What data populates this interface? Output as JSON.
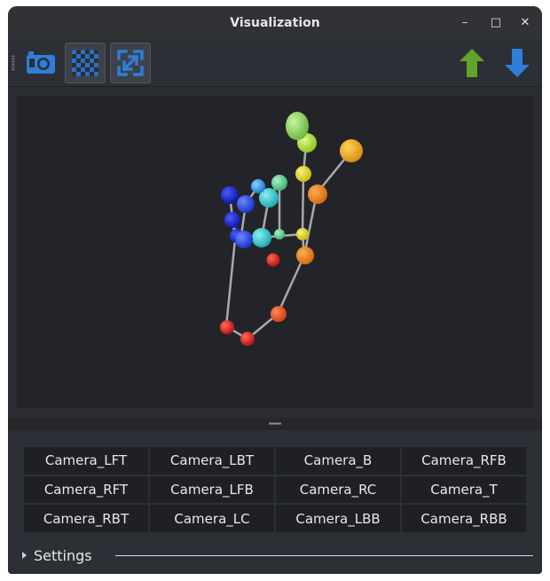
{
  "window": {
    "title": "Visualization",
    "minimize_glyph": "–",
    "maximize_glyph": "□",
    "close_glyph": "✕"
  },
  "toolbar": {
    "buttons": [
      {
        "icon": "camera-icon",
        "checked": false
      },
      {
        "icon": "checkerboard-icon",
        "checked": true
      },
      {
        "icon": "fit-view-icon",
        "checked": true
      }
    ],
    "right_buttons": [
      {
        "icon": "arrow-up-icon",
        "color": "#5fa52b"
      },
      {
        "icon": "arrow-down-icon",
        "color": "#2f7ed8"
      }
    ]
  },
  "cameras": {
    "labels": [
      "Camera_LFT",
      "Camera_LBT",
      "Camera_B",
      "Camera_RFB",
      "Camera_RFT",
      "Camera_LFB",
      "Camera_RC",
      "Camera_T",
      "Camera_RBT",
      "Camera_LC",
      "Camera_LBB",
      "Camera_RBB"
    ]
  },
  "settings": {
    "label": "Settings",
    "expanded": false
  },
  "colors": {
    "accent_blue": "#2f7ed8",
    "accent_green": "#5fa52b",
    "viewport_bg": "#232429"
  }
}
